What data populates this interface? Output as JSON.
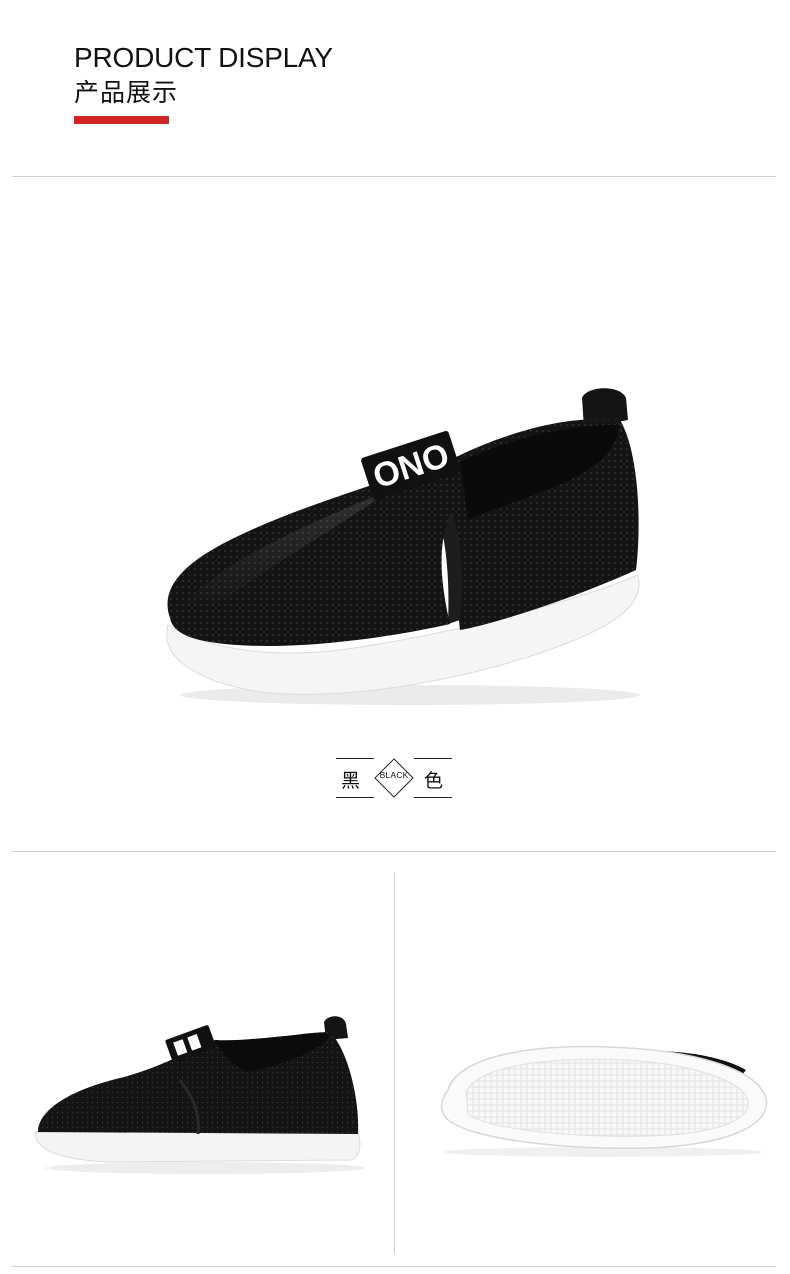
{
  "header": {
    "title_en": "PRODUCT DISPLAY",
    "title_cn": "产品展示",
    "accent_color": "#d32222"
  },
  "color_option": {
    "name_cn_left": "黑",
    "name_cn_right": "色",
    "name_en": "BLACK"
  },
  "product": {
    "tongue_tag_text": "ONO",
    "shoe_color": "#141414",
    "sole_color": "#f5f5f5"
  },
  "images": {
    "main": "main-shoe-image",
    "side": "side-view-image",
    "sole": "sole-view-image"
  }
}
